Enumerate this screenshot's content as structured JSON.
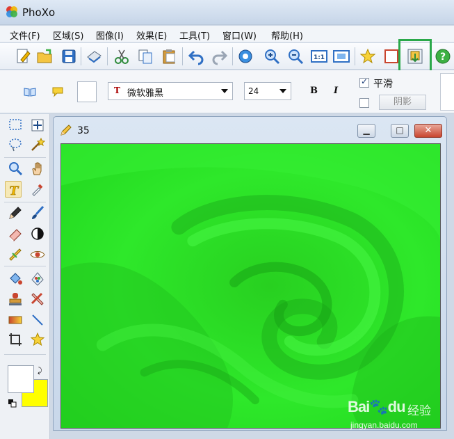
{
  "window": {
    "title": "PhoXo"
  },
  "menu": {
    "items": [
      "文件(F)",
      "区域(S)",
      "图像(I)",
      "效果(E)",
      "工具(T)",
      "窗口(W)",
      "帮助(H)"
    ]
  },
  "toolbar": {
    "buttons": [
      "new",
      "open",
      "save",
      "print",
      "cut",
      "copy",
      "paste",
      "undo",
      "redo",
      "rotate",
      "zoom-in",
      "zoom-out",
      "actual-size",
      "fit-window",
      "favorite",
      "frame",
      "export",
      "help"
    ],
    "highlighted": "export"
  },
  "text_options": {
    "font_name": "微软雅黑",
    "font_icon": "T",
    "font_size": "24",
    "bold_label": "B",
    "italic_label": "I",
    "smooth_label": "平滑",
    "smooth_checked": true,
    "shadow_label": "阴影",
    "shadow_checked": false
  },
  "palette": {
    "foreground_color": "#ffffff",
    "background_color": "#ffff00",
    "active_tool": "text"
  },
  "document": {
    "title": "35",
    "min_glyph": "▁",
    "max_glyph": "□",
    "close_glyph": "✕"
  },
  "watermark": {
    "brand": "Bai",
    "brand_suffix": "du",
    "cn": "经验",
    "url": "jingyan.baidu.com"
  },
  "colors": {
    "accent_highlight": "#2aa84a",
    "canvas_green": "#1fe31f"
  }
}
